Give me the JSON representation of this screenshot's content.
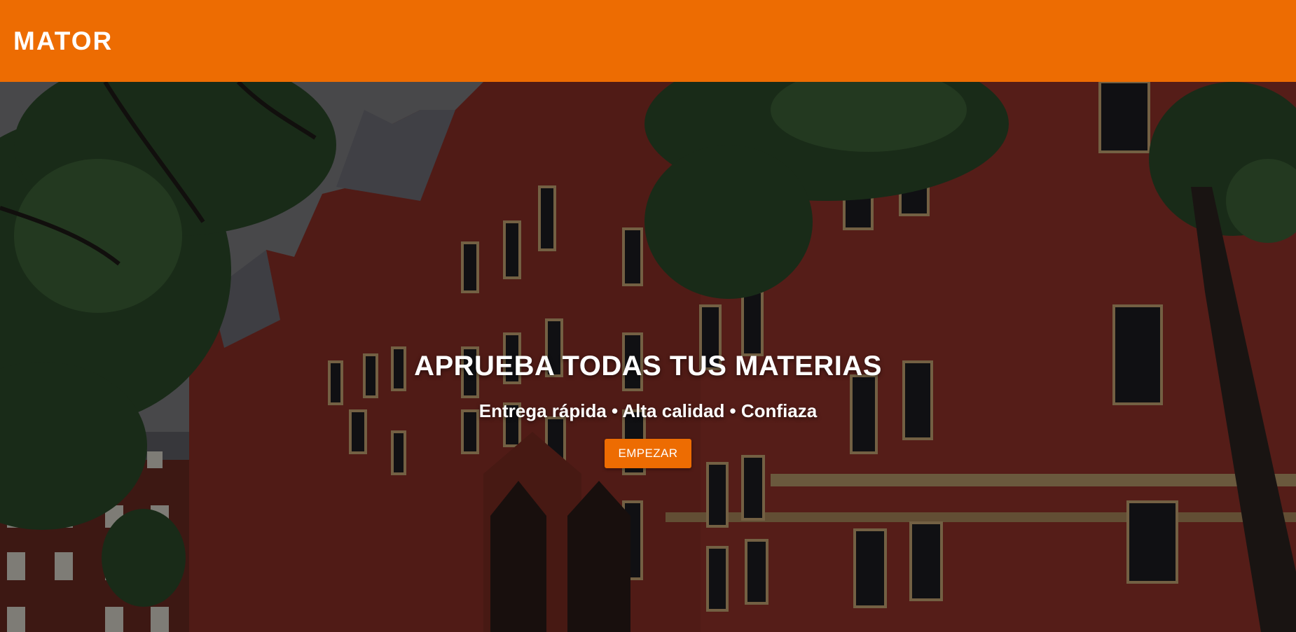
{
  "navbar": {
    "brand": "MATOR",
    "color": "#ed6c02"
  },
  "hero": {
    "background_image": "university-building-photo",
    "title": "APRUEBA TODAS TUS MATERIAS",
    "subtitle": "Entrega rápida • Alta calidad • Confiaza",
    "cta_label": "EMPEZAR"
  }
}
